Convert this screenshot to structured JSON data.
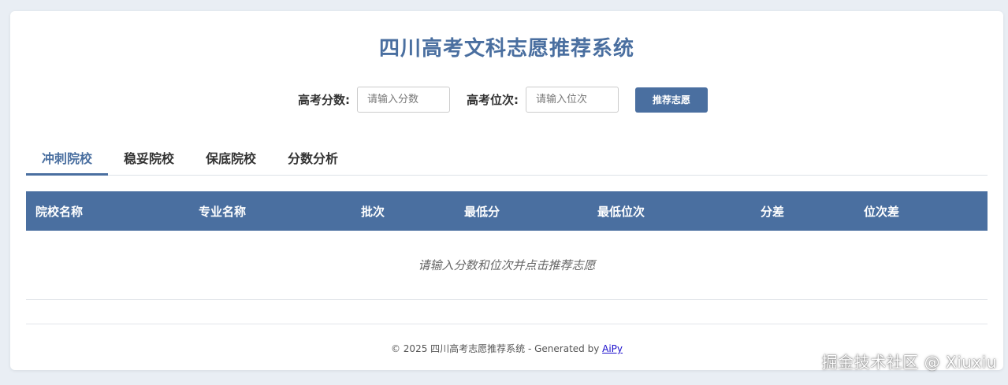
{
  "header": {
    "title": "四川高考文科志愿推荐系统"
  },
  "form": {
    "score_label": "高考分数:",
    "score_placeholder": "请输入分数",
    "rank_label": "高考位次:",
    "rank_placeholder": "请输入位次",
    "submit_label": "推荐志愿"
  },
  "tabs": [
    {
      "label": "冲刺院校",
      "active": true
    },
    {
      "label": "稳妥院校",
      "active": false
    },
    {
      "label": "保底院校",
      "active": false
    },
    {
      "label": "分数分析",
      "active": false
    }
  ],
  "table": {
    "columns": [
      "院校名称",
      "专业名称",
      "批次",
      "最低分",
      "最低位次",
      "分差",
      "位次差"
    ],
    "empty_message": "请输入分数和位次并点击推荐志愿"
  },
  "footer": {
    "text": "© 2025 四川高考志愿推荐系统 - Generated by ",
    "link_label": "AiPy"
  },
  "watermark": "掘金技术社区 @ Xiuxiu",
  "colors": {
    "accent": "#4a6fa0",
    "background": "#e9eef4"
  }
}
